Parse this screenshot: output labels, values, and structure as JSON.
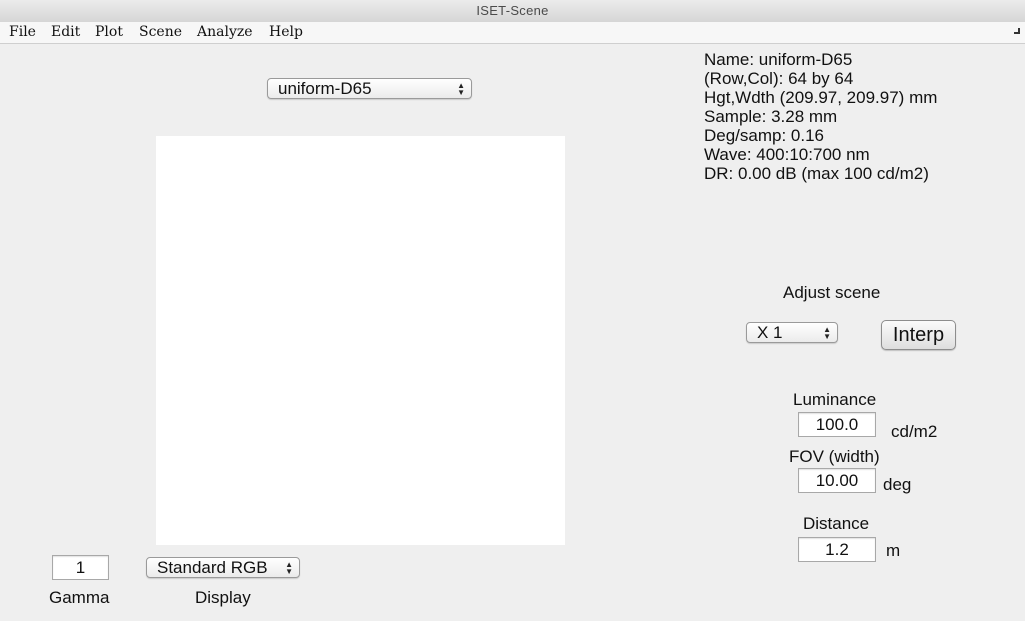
{
  "window": {
    "title": "ISET-Scene"
  },
  "menu": [
    "File",
    "Edit",
    "Plot",
    "Scene",
    "Analyze",
    "Help"
  ],
  "scene_selector": {
    "selected": "uniform-D65"
  },
  "scene_info": [
    "Name: uniform-D65",
    "(Row,Col): 64 by 64",
    "Hgt,Wdth (209.97, 209.97) mm",
    "Sample: 3.28 mm",
    "Deg/samp: 0.16",
    "Wave: 400:10:700 nm",
    "DR: 0.00 dB (max 100 cd/m2)"
  ],
  "adjust": {
    "title": "Adjust scene",
    "scale_selected": "X 1",
    "interp_label": "Interp"
  },
  "luminance": {
    "label": "Luminance",
    "value": "100.0",
    "unit": "cd/m2"
  },
  "fov": {
    "label": "FOV (width)",
    "value": "10.00",
    "unit": "deg"
  },
  "distance": {
    "label": "Distance",
    "value": "1.2",
    "unit": "m"
  },
  "gamma": {
    "value": "1",
    "label": "Gamma"
  },
  "display": {
    "selected": "Standard RGB",
    "label": "Display"
  },
  "colors": {
    "background": "#efefef",
    "image_panel": "#ffffff"
  }
}
